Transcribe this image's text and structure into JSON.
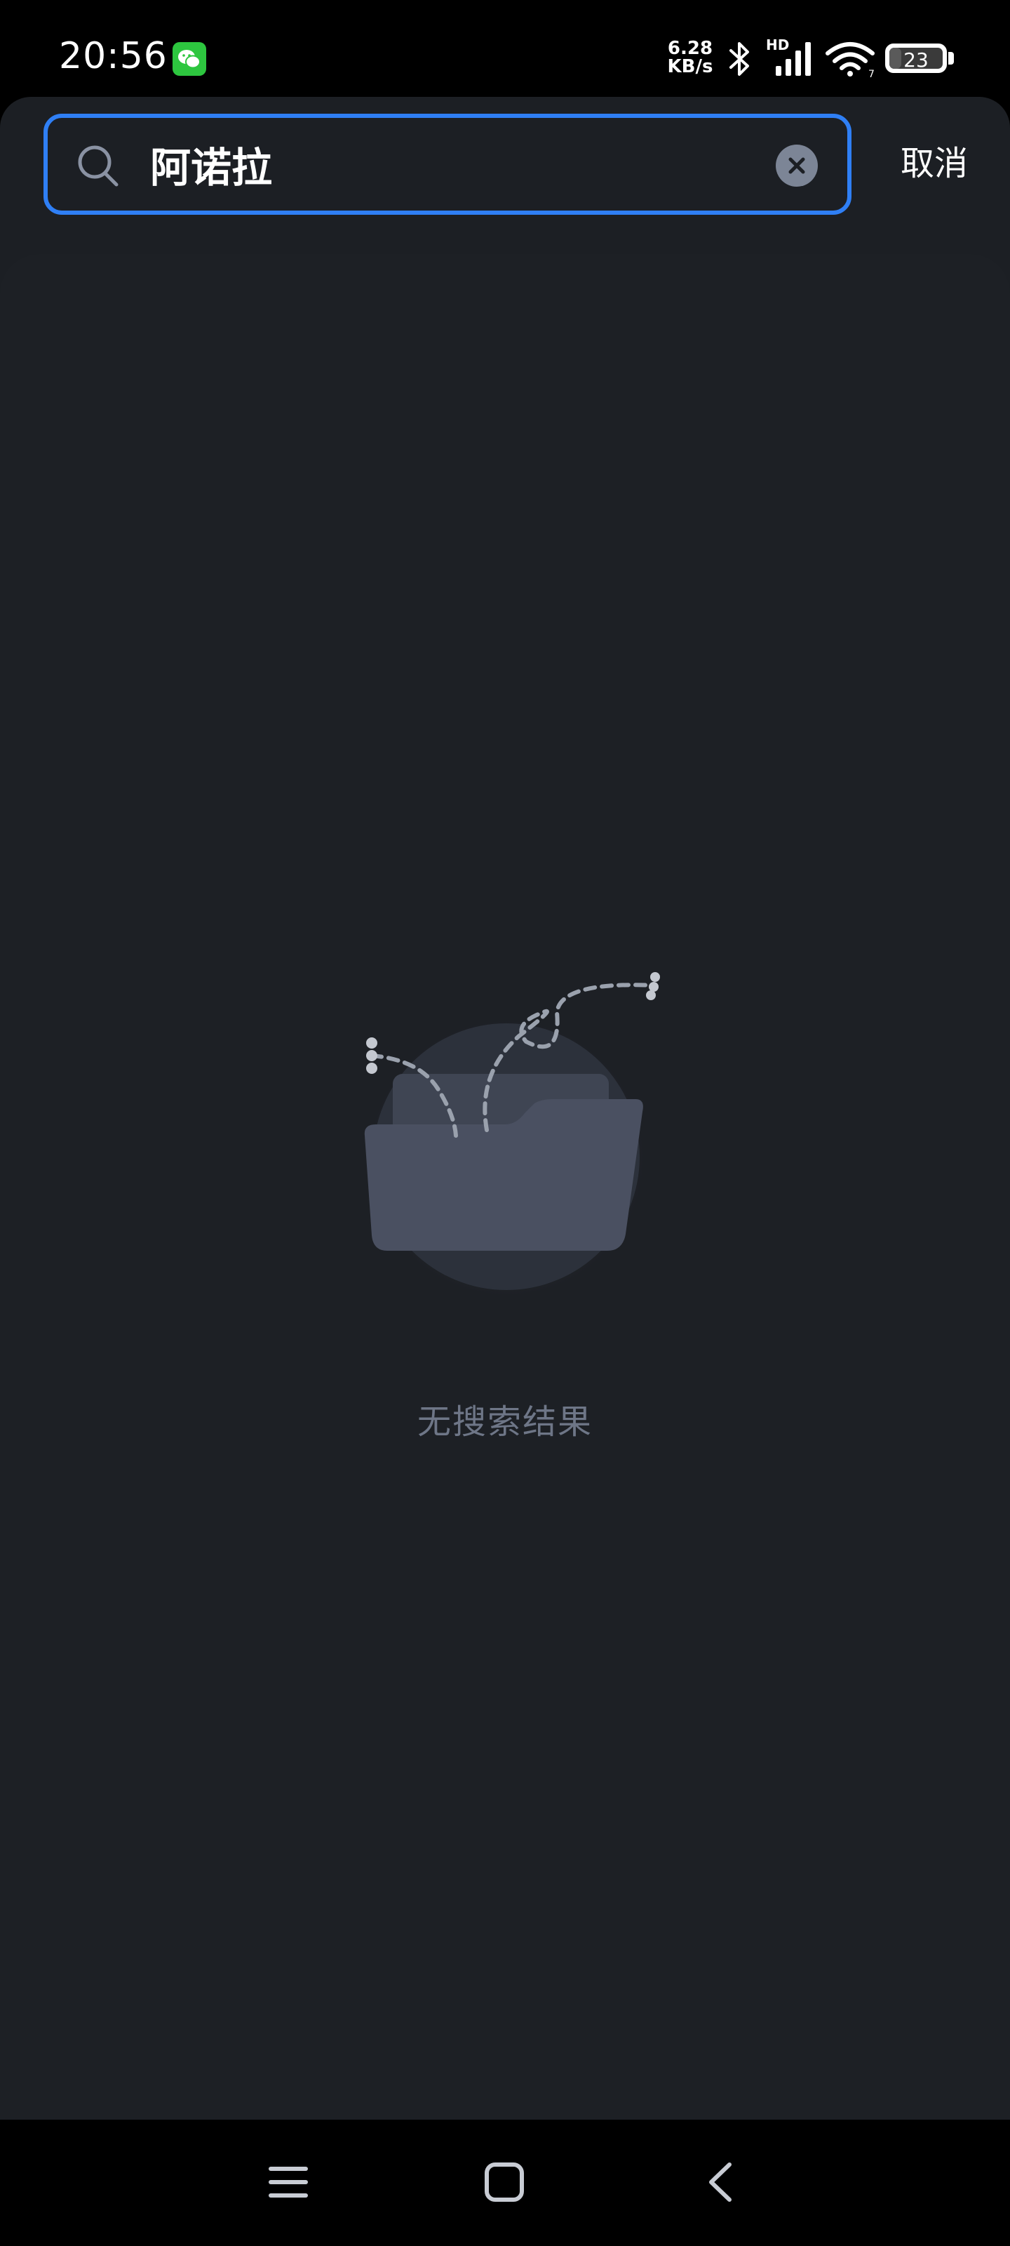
{
  "status_bar": {
    "time": "20:56",
    "net_speed_value": "6.28",
    "net_speed_unit": "KB/s",
    "hd_label": "HD",
    "battery_level": "23",
    "battery_fraction": 0.23,
    "icons": [
      "wechat-icon",
      "bluetooth-icon",
      "signal-icon",
      "wifi-icon",
      "battery-icon"
    ]
  },
  "search": {
    "query": "阿诺拉",
    "accent_color": "#2f7ff5",
    "icons": [
      "search-icon",
      "clear-icon"
    ]
  },
  "header": {
    "cancel_label": "取消"
  },
  "results": {
    "empty_message": "无搜索结果",
    "illustration": "empty-folder-illustration"
  },
  "nav_bar": {
    "icons": [
      "menu-icon",
      "home-icon",
      "back-icon"
    ]
  }
}
